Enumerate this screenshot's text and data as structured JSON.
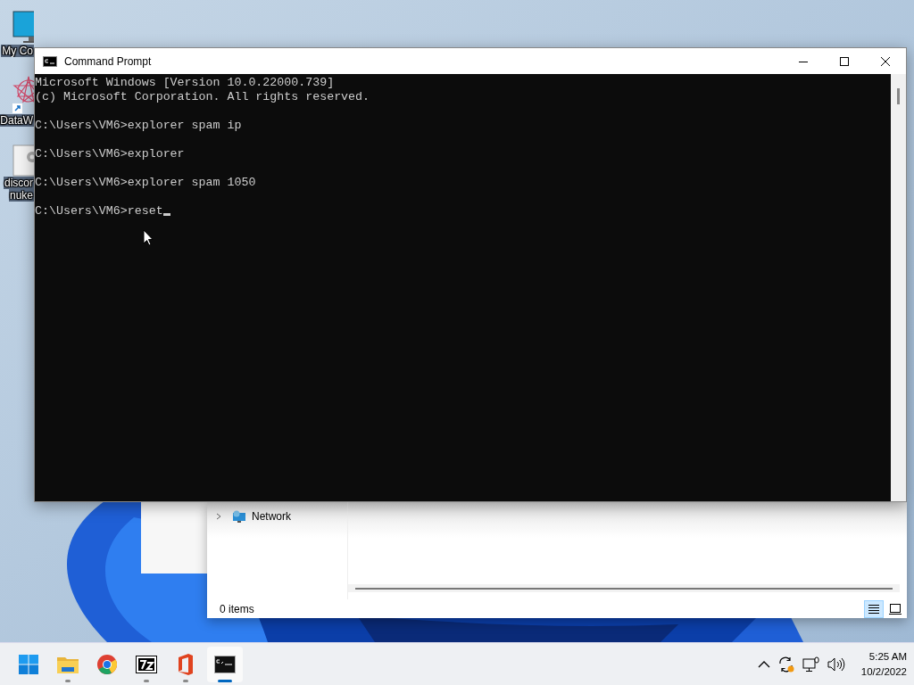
{
  "desktop": {
    "icons": [
      {
        "kind": "monitor",
        "lines": [
          "My Co"
        ]
      },
      {
        "kind": "shortcut",
        "lines": [
          "DataW"
        ]
      },
      {
        "kind": "document",
        "lines": [
          "discor",
          "nuke"
        ]
      }
    ]
  },
  "explorer": {
    "tree": [
      {
        "label": "Network",
        "expanded": false
      }
    ],
    "status": "0 items",
    "views": [
      {
        "kind": "details",
        "selected": true
      },
      {
        "kind": "tiles",
        "selected": false
      }
    ]
  },
  "cmd": {
    "title": "Command Prompt",
    "header": [
      "Microsoft Windows [Version 10.0.22000.739]",
      "(c) Microsoft Corporation. All rights reserved."
    ],
    "commands": [
      {
        "text": "C:\\Users\\VM6>explorer spam ip",
        "cursor": false
      },
      {
        "text": "C:\\Users\\VM6>explorer",
        "cursor": false
      },
      {
        "text": "C:\\Users\\VM6>explorer spam 1050",
        "cursor": false
      },
      {
        "text": "C:\\Users\\VM6>reset",
        "cursor": true
      }
    ]
  },
  "taskbar": {
    "apps": [
      {
        "kind": "start",
        "running": false,
        "active": false
      },
      {
        "kind": "folder",
        "running": true,
        "active": false
      },
      {
        "kind": "browser",
        "running": false,
        "active": false
      },
      {
        "kind": "archiver",
        "running": true,
        "active": false
      },
      {
        "kind": "office",
        "running": true,
        "active": false
      },
      {
        "kind": "terminal",
        "running": true,
        "active": true
      }
    ],
    "clock": {
      "time": "5:25 AM",
      "date": "10/2/2022"
    }
  }
}
